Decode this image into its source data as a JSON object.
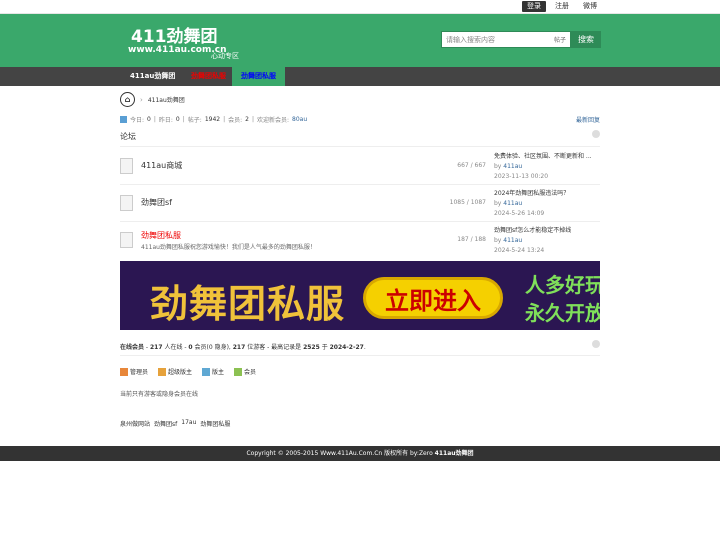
{
  "topbar": {
    "login": "登录",
    "register": "注册",
    "weibo": "微博"
  },
  "header": {
    "title": "411劲舞团",
    "url": "www.411au.com.cn",
    "tag": "心动专区",
    "search_placeholder": "请输入搜索内容",
    "search_scope": "帖子",
    "search_button": "搜索"
  },
  "nav": [
    "411au劲舞团",
    "劲舞团私服",
    "劲舞团私服"
  ],
  "breadcrumb": {
    "sep": "›",
    "label": "411au劲舞团"
  },
  "stats": {
    "today_label": "今日:",
    "today": "0",
    "yesterday_label": "昨日:",
    "yesterday": "0",
    "posts_label": "帖子:",
    "posts": "1942",
    "members_label": "会员:",
    "members": "2",
    "welcome_label": "欢迎新会员:",
    "newest": "80au",
    "latest_reply": "最新回复"
  },
  "section_title": "论坛",
  "forums": [
    {
      "name": "411au商城",
      "desc": "",
      "count": "667 / 667",
      "last_title": "免费体验、社区氛围、不断更新和 ...",
      "by": "by",
      "author": "411au",
      "date": "2023-11-13 00:20"
    },
    {
      "name": "劲舞团sf",
      "desc": "",
      "count": "1085 / 1087",
      "last_title": "2024年劲舞团私服违法吗？",
      "by": "by",
      "author": "411au",
      "date": "2024-5-26 14:09"
    },
    {
      "name": "劲舞团私服",
      "desc": "411au劲舞团私服祝您游戏愉快！我们是人气最多的劲舞团私服！",
      "count": "187 / 188",
      "last_title": "劲舞团sf怎么才能稳定不掉线",
      "by": "by",
      "author": "411au",
      "date": "2024-5-24 13:24"
    }
  ],
  "banner": {
    "main": "劲舞团私服",
    "cta": "立即进入",
    "right1": "人多好玩",
    "right2": "永久开放"
  },
  "online": {
    "label": "在线会员",
    "dash": " - ",
    "total": "217",
    "t1": " 人在线 - ",
    "members": "0",
    "t2": " 会员(0 隐身), ",
    "guests": "217",
    "t3": " 位游客 - 最高记录是 ",
    "record": "2525",
    "t4": " 于 ",
    "record_date": "2024-2-27",
    "t5": "."
  },
  "legend": [
    {
      "label": "管理员",
      "color": "#e8873a"
    },
    {
      "label": "超级版主",
      "color": "#e6a23c"
    },
    {
      "label": "版主",
      "color": "#5fa8d3"
    },
    {
      "label": "会员",
      "color": "#8cc152"
    }
  ],
  "no_member": "当前只有游客或隐身会员在线",
  "friend_links": [
    "泉州做网站",
    "劲舞团sf",
    "17au",
    "劲舞团私服"
  ],
  "footer": {
    "text": "Copyright © 2005-2015 Www.411Au.Com.Cn 版权所有 by:Zero ",
    "brand": "411au劲舞团"
  }
}
